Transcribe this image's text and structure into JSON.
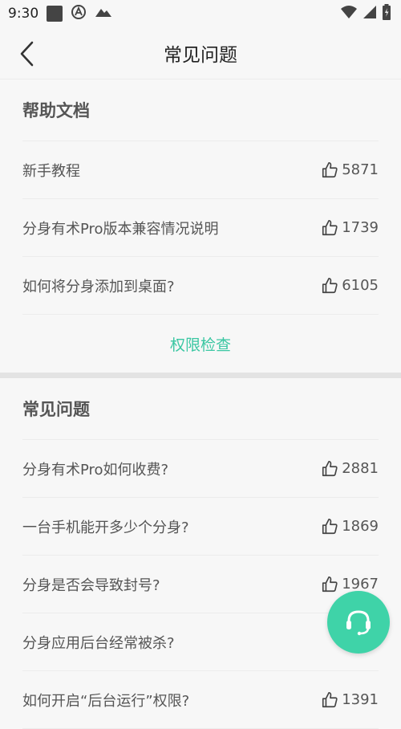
{
  "status": {
    "time": "9:30"
  },
  "header": {
    "title": "常见问题"
  },
  "help_docs": {
    "heading": "帮助文档",
    "items": [
      {
        "label": "新手教程",
        "likes": "5871"
      },
      {
        "label": "分身有术Pro版本兼容情况说明",
        "likes": "1739"
      },
      {
        "label": "如何将分身添加到桌面?",
        "likes": "6105"
      }
    ],
    "link_label": "权限检查"
  },
  "faq": {
    "heading": "常见问题",
    "items": [
      {
        "label": "分身有术Pro如何收费?",
        "likes": "2881"
      },
      {
        "label": "一台手机能开多少个分身?",
        "likes": "1869"
      },
      {
        "label": "分身是否会导致封号?",
        "likes": "1967"
      },
      {
        "label": "分身应用后台经常被杀?",
        "likes": ""
      },
      {
        "label": "如何开启“后台运行”权限?",
        "likes": "1391"
      }
    ]
  },
  "colors": {
    "accent": "#3bc7a3",
    "fab": "#3fd3a8"
  },
  "icons": {
    "back": "chevron-left-icon",
    "like": "thumbs-up-icon",
    "support": "headset-icon"
  }
}
